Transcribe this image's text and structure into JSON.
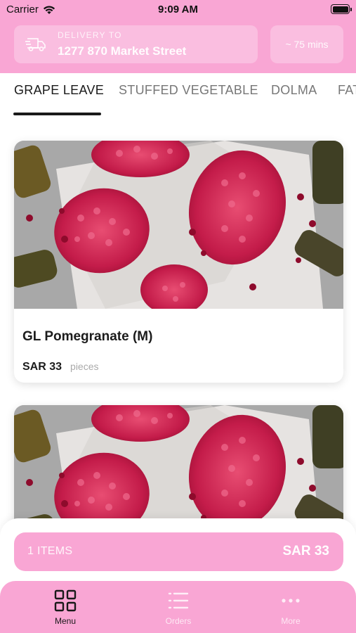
{
  "status_bar": {
    "carrier": "Carrier",
    "time": "9:09 AM"
  },
  "delivery": {
    "label": "DELIVERY TO",
    "address": "1277 870 Market Street",
    "eta": "~ 75 mins"
  },
  "tabs": [
    {
      "label": "GRAPE LEAVE",
      "active": true
    },
    {
      "label": "STUFFED VEGETABLE",
      "active": false
    },
    {
      "label": "DOLMA",
      "active": false
    },
    {
      "label": "FAT",
      "active": false
    }
  ],
  "products": [
    {
      "name": "GL Pomegranate (M)",
      "price": "SAR 33",
      "unit": "pieces",
      "image": "pomegranate-grape-leaves-photo"
    },
    {
      "name": "",
      "price": "",
      "unit": "",
      "image": "pomegranate-grape-leaves-photo"
    }
  ],
  "cart": {
    "count_label": "1 ITEMS",
    "total": "SAR 33"
  },
  "nav": [
    {
      "label": "Menu",
      "icon": "grid-icon",
      "active": true
    },
    {
      "label": "Orders",
      "icon": "list-icon",
      "active": false
    },
    {
      "label": "More",
      "icon": "more-icon",
      "active": false
    }
  ],
  "colors": {
    "brand_pink": "#f9a6d4",
    "text_dark": "#1a1a1a",
    "muted": "#aaaaaa"
  }
}
